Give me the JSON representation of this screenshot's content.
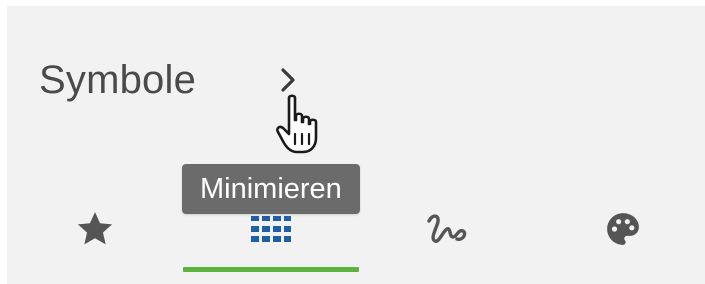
{
  "panel": {
    "title": "Symbole",
    "collapse_icon": "chevron-right-icon",
    "tooltip": "Minimieren"
  },
  "tabs": [
    {
      "icon": "star-icon",
      "active": false
    },
    {
      "icon": "grid-icon",
      "active": true
    },
    {
      "icon": "signature-icon",
      "active": false
    },
    {
      "icon": "palette-icon",
      "active": false
    }
  ],
  "colors": {
    "panel_background": "#f2f2f2",
    "title_text": "#4a4a4a",
    "icon_default": "#555555",
    "icon_active": "#1f5fa8",
    "active_underline": "#5db342",
    "tooltip_background": "#6b6b6b",
    "tooltip_text": "#ffffff"
  },
  "cursor": "hand-pointer-cursor"
}
